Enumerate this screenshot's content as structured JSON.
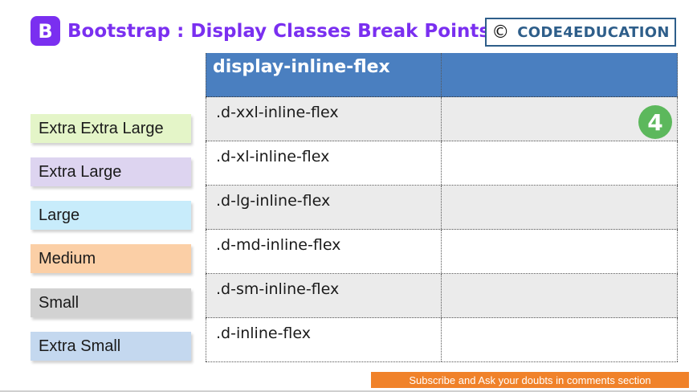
{
  "header": {
    "logo_letter": "B",
    "title": "Bootstrap : Display Classes Break Points",
    "copyright_symbol": "©",
    "brand": "CODE4EDUCATION",
    "accent_color": "#7a2ff0"
  },
  "breakpoints": [
    {
      "label": "Extra Extra Large",
      "color": "#e4f5c8"
    },
    {
      "label": "Extra Large",
      "color": "#ddd4f0"
    },
    {
      "label": "Large",
      "color": "#c8ecfb"
    },
    {
      "label": "Medium",
      "color": "#fbcfa6"
    },
    {
      "label": "Small",
      "color": "#d2d2d2"
    },
    {
      "label": "Extra Small",
      "color": "#c4d8ef"
    }
  ],
  "table": {
    "header": "display-inline-flex",
    "header_color": "#4a7fc0",
    "rows": [
      ".d-xxl-inline-flex",
      ".d-xl-inline-flex",
      ".d-lg-inline-flex",
      ".d-md-inline-flex",
      ".d-sm-inline-flex",
      ".d-inline-flex"
    ],
    "badge_glyph": "4"
  },
  "footer": {
    "subscribe": "Subscribe and Ask your doubts in comments section"
  }
}
